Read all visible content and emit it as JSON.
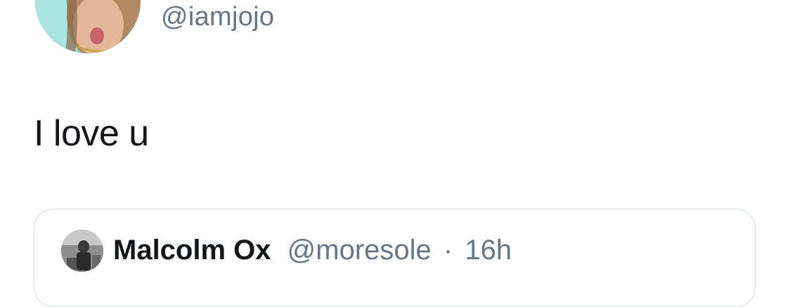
{
  "tweet": {
    "handle": "@iamjojo",
    "text": "I love u"
  },
  "quoted_tweet": {
    "author_name": "Malcolm Ox",
    "author_handle": "@moresole",
    "separator": "·",
    "time": "16h"
  },
  "icons": {
    "author_avatar": "profile-photo",
    "quoted_avatar": "profile-photo"
  },
  "colors": {
    "text_primary": "#14171a",
    "text_secondary": "#657786",
    "card_border": "#cfd9de",
    "background": "#ffffff"
  }
}
